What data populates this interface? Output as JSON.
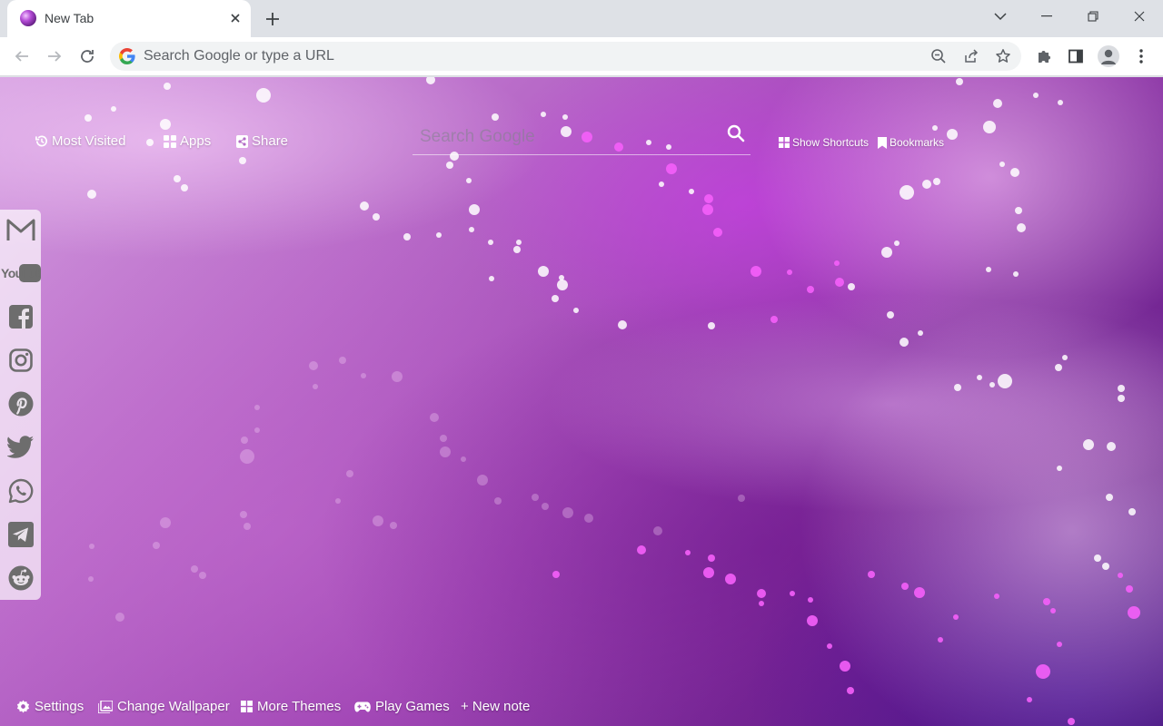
{
  "browser": {
    "tab": {
      "title": "New Tab"
    },
    "omnibox": {
      "placeholder": "Search Google or type a URL"
    }
  },
  "newtab": {
    "top_links": {
      "most_visited": "Most Visited",
      "apps": "Apps",
      "share": "Share"
    },
    "search": {
      "placeholder": "Search Google"
    },
    "right_links": {
      "show_shortcuts": "Show Shortcuts",
      "bookmarks": "Bookmarks"
    },
    "social_sidebar": [
      {
        "name": "Gmail",
        "icon": "gmail-icon"
      },
      {
        "name": "YouTube",
        "icon": "youtube-icon",
        "wordmark": "YouTube"
      },
      {
        "name": "Facebook",
        "icon": "facebook-icon"
      },
      {
        "name": "Instagram",
        "icon": "instagram-icon"
      },
      {
        "name": "Pinterest",
        "icon": "pinterest-icon"
      },
      {
        "name": "Twitter",
        "icon": "twitter-icon"
      },
      {
        "name": "WhatsApp",
        "icon": "whatsapp-icon"
      },
      {
        "name": "Telegram",
        "icon": "telegram-icon"
      },
      {
        "name": "Reddit",
        "icon": "reddit-icon"
      }
    ],
    "bottom_bar": {
      "settings": "Settings",
      "change_wallpaper": "Change Wallpaper",
      "more_themes": "More Themes",
      "play_games": "Play Games",
      "new_note": "+ New note"
    }
  },
  "colors": {
    "wallpaper_primary": "#9a3fb0",
    "wallpaper_dark": "#4a1670",
    "particle_pink": "#f05cf5",
    "sidebar_icon": "#6d6d6d"
  }
}
